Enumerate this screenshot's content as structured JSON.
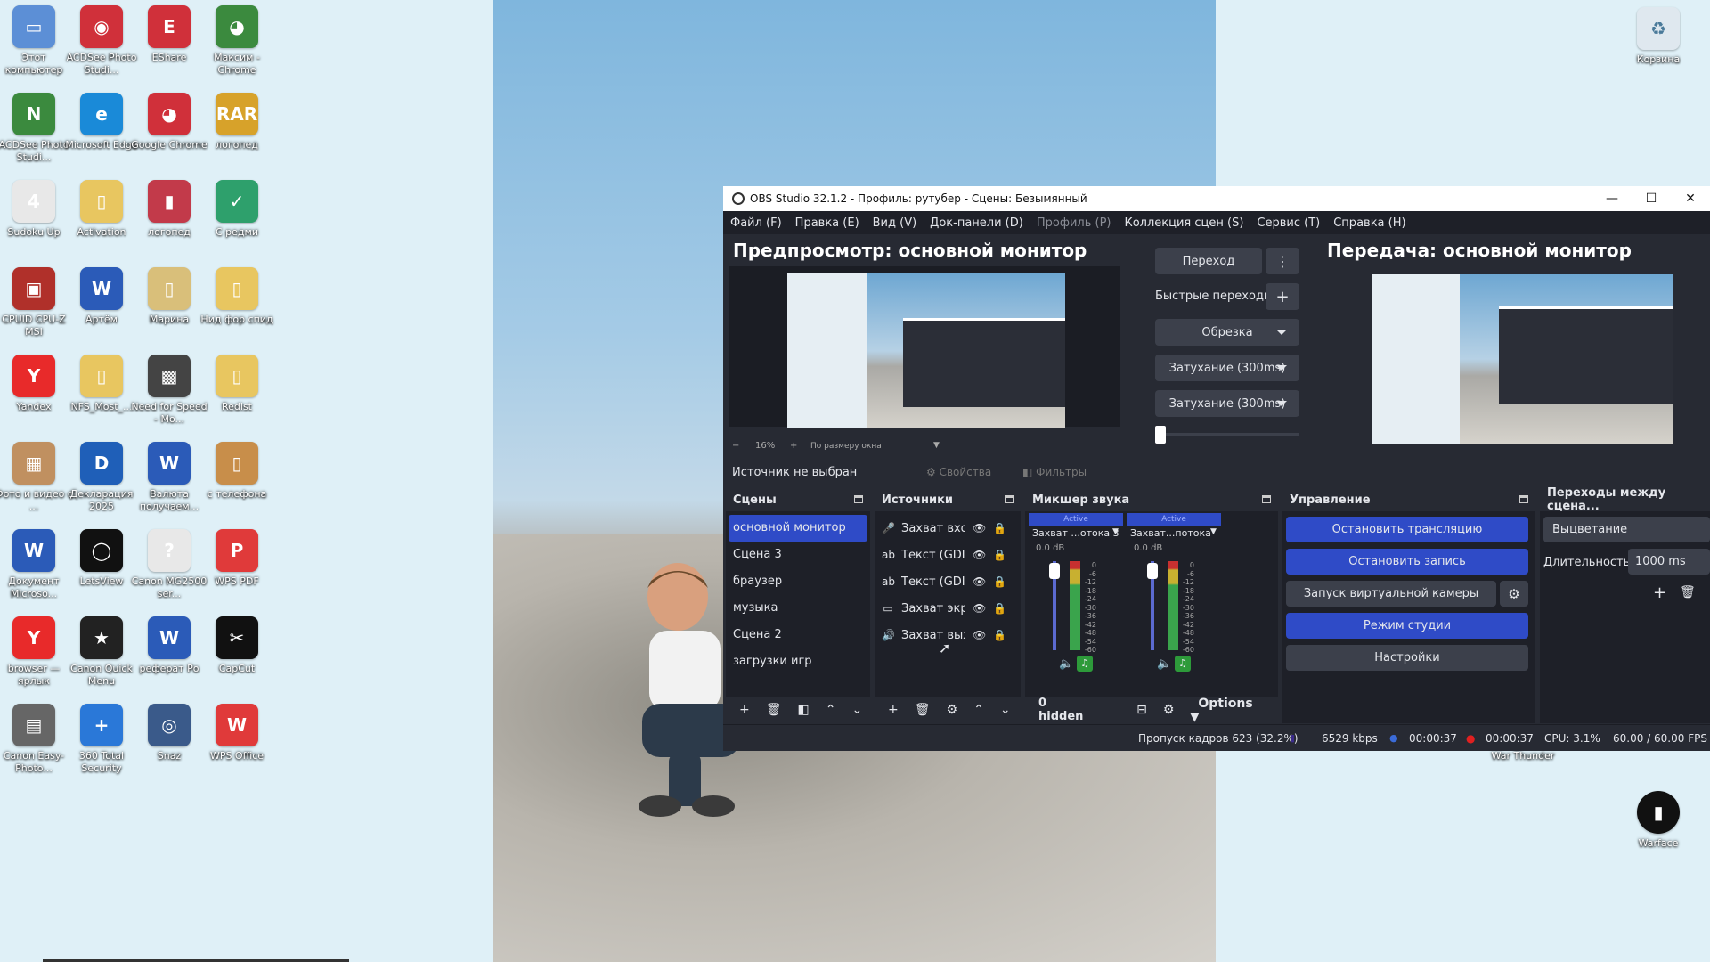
{
  "desktop": {
    "icons": [
      {
        "label": "Этот компьютер",
        "color": "#5c8fd6",
        "glyph": "▭"
      },
      {
        "label": "ACDSee Photo Studi...",
        "color": "#d0303a",
        "glyph": "◉"
      },
      {
        "label": "EShare",
        "color": "#d0303a",
        "glyph": "E"
      },
      {
        "label": "Максим - Chrome",
        "color": "#3b8a3e",
        "glyph": "◕"
      },
      {
        "label": "ACDSee Photo Studi...",
        "color": "#3b8a3e",
        "glyph": "N"
      },
      {
        "label": "Microsoft Edge",
        "color": "#1a8ad8",
        "glyph": "e"
      },
      {
        "label": "Google Chrome",
        "color": "#d0303a",
        "glyph": "◕"
      },
      {
        "label": "логопед",
        "color": "#d7a22a",
        "glyph": "RAR"
      },
      {
        "label": "Sudoku Up",
        "color": "#e8e8e8",
        "glyph": "4"
      },
      {
        "label": "Activation",
        "color": "#e8c660",
        "glyph": "▯"
      },
      {
        "label": "логопед",
        "color": "#c23a4a",
        "glyph": "▮"
      },
      {
        "label": "С редми",
        "color": "#2ea06c",
        "glyph": "✓"
      },
      {
        "label": "CPUID CPU-Z MSI",
        "color": "#b0302a",
        "glyph": "▣"
      },
      {
        "label": "Артём",
        "color": "#2b5bb8",
        "glyph": "W"
      },
      {
        "label": "Марина",
        "color": "#d9bf7a",
        "glyph": "▯"
      },
      {
        "label": "Нид фор спид",
        "color": "#e8c660",
        "glyph": "▯"
      },
      {
        "label": "Yandex",
        "color": "#e82a2a",
        "glyph": "Y"
      },
      {
        "label": "NFS_Most_...",
        "color": "#e8c660",
        "glyph": "▯"
      },
      {
        "label": "Need for Speed - Mo...",
        "color": "#444",
        "glyph": "▩"
      },
      {
        "label": "Redist",
        "color": "#e8c660",
        "glyph": "▯"
      },
      {
        "label": "Фото и видео с ...",
        "color": "#c09060",
        "glyph": "▦"
      },
      {
        "label": "Декларация 2025",
        "color": "#1f5fb8",
        "glyph": "D"
      },
      {
        "label": "Валюта получаем...",
        "color": "#2b5bb8",
        "glyph": "W"
      },
      {
        "label": "с телефона",
        "color": "#c88e4a",
        "glyph": "▯"
      },
      {
        "label": "Документ Microso...",
        "color": "#2b5bb8",
        "glyph": "W"
      },
      {
        "label": "LetsView",
        "color": "#111",
        "glyph": "◯"
      },
      {
        "label": "Canon MG2500 ser...",
        "color": "#e8e8e8",
        "glyph": "?"
      },
      {
        "label": "WPS PDF",
        "color": "#e03a3a",
        "glyph": "P"
      },
      {
        "label": "browser — ярлык",
        "color": "#e82a2a",
        "glyph": "Y"
      },
      {
        "label": "Canon Quick Menu",
        "color": "#222",
        "glyph": "★"
      },
      {
        "label": "реферат Ро",
        "color": "#2b5bb8",
        "glyph": "W"
      },
      {
        "label": "CapCut",
        "color": "#111",
        "glyph": "✂"
      },
      {
        "label": "Canon Easy-Photo...",
        "color": "#666",
        "glyph": "▤"
      },
      {
        "label": "360 Total Security",
        "color": "#2a78d8",
        "glyph": "+"
      },
      {
        "label": "Snaz",
        "color": "#3a5a8a",
        "glyph": "◎"
      },
      {
        "label": "WPS Office",
        "color": "#e03a3a",
        "glyph": "W"
      }
    ],
    "right_icons": [
      {
        "label": "Корзина",
        "color": "#dfe8ef",
        "glyph": "♻"
      },
      {
        "label": "Warface",
        "color": "#111",
        "glyph": "▮"
      }
    ],
    "war_thunder_label": "War Thunder"
  },
  "obs": {
    "window_title": "OBS Studio 32.1.2 - Профиль: рутубер - Сцены: Безымянный",
    "menu": [
      "Файл (F)",
      "Правка (E)",
      "Вид (V)",
      "Док-панели (D)",
      "Профиль (P)",
      "Коллекция сцен (S)",
      "Сервис (T)",
      "Справка (H)"
    ],
    "preview_title": "Предпросмотр: основной монитор",
    "program_title": "Передача: основной монитор",
    "zoom_text": "16%",
    "fit_text": "По размеру окна",
    "transition_button": "Переход",
    "quick_transitions": "Быстрые переходы",
    "crop_dropdown": "Обрезка",
    "fade1": "Затухание (300ms)",
    "fade2": "Затухание (300ms)",
    "no_source": "Источник не выбран",
    "properties_btn": "Свойства",
    "filters_btn": "Фильтры",
    "scenes": {
      "title": "Сцены",
      "items": [
        "основной монитор",
        "Сцена 3",
        "браузер",
        "музыка",
        "Сцена 2",
        "загрузки игр"
      ]
    },
    "sources": {
      "title": "Источники",
      "items": [
        {
          "icon": "🎤",
          "name": "Захват входного"
        },
        {
          "icon": "ab",
          "name": "Текст (GDI+)"
        },
        {
          "icon": "ab",
          "name": "Текст (GDI+)"
        },
        {
          "icon": "▭",
          "name": "Захват экрана"
        },
        {
          "icon": "🔊",
          "name": "Захват выхода"
        }
      ]
    },
    "mixer": {
      "title": "Микшер звука",
      "channels": [
        {
          "active": "Active",
          "name": "Захват ...отока 3",
          "db": "0.0 dB"
        },
        {
          "active": "Active",
          "name": "Захват...потока",
          "db": "0.0 dB"
        }
      ],
      "ticks": [
        "0",
        "-6",
        "-12",
        "-18",
        "-24",
        "-30",
        "-36",
        "-42",
        "-48",
        "-54",
        "-60"
      ],
      "hidden": "0 hidden",
      "options": "Options"
    },
    "controls": {
      "title": "Управление",
      "stop_stream": "Остановить трансляцию",
      "stop_record": "Остановить запись",
      "virtual_cam": "Запуск виртуальной камеры",
      "studio_mode": "Режим студии",
      "settings": "Настройки"
    },
    "transitions": {
      "title": "Переходы между сцена...",
      "selected": "Выцветание",
      "duration_label": "Длительность",
      "duration_value": "1000 ms"
    },
    "status": {
      "dropped": "Пропуск кадров 623 (32.2%)",
      "bitrate": "6529 kbps",
      "stream_time": "00:00:37",
      "record_time": "00:00:37",
      "cpu": "CPU: 3.1%",
      "fps": "60.00 / 60.00 FPS"
    }
  }
}
